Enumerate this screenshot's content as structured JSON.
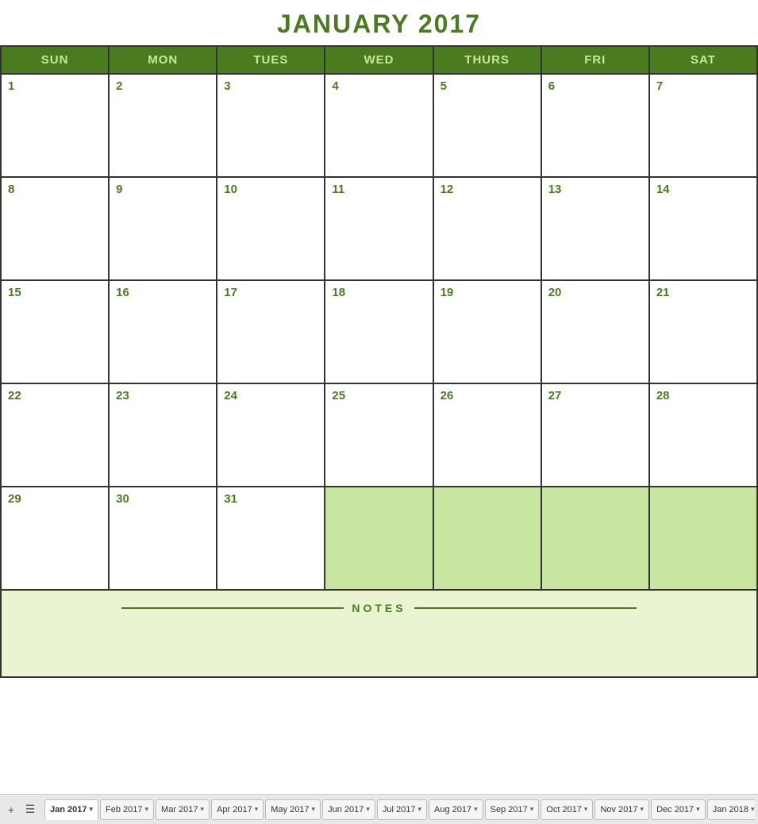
{
  "title": "JANUARY 2017",
  "colors": {
    "header_bg": "#4a7c1f",
    "header_text": "#c8e6a0",
    "date_text": "#4a7c1f",
    "empty_cell_bg": "#c8e6a0",
    "notes_bg": "#e8f5d0"
  },
  "day_headers": [
    "SUN",
    "MON",
    "TUES",
    "WED",
    "THURS",
    "FRI",
    "SAT"
  ],
  "weeks": [
    [
      {
        "date": "1",
        "empty": false
      },
      {
        "date": "2",
        "empty": false
      },
      {
        "date": "3",
        "empty": false
      },
      {
        "date": "4",
        "empty": false
      },
      {
        "date": "5",
        "empty": false
      },
      {
        "date": "6",
        "empty": false
      },
      {
        "date": "7",
        "empty": false
      }
    ],
    [
      {
        "date": "8",
        "empty": false
      },
      {
        "date": "9",
        "empty": false
      },
      {
        "date": "10",
        "empty": false
      },
      {
        "date": "11",
        "empty": false
      },
      {
        "date": "12",
        "empty": false
      },
      {
        "date": "13",
        "empty": false
      },
      {
        "date": "14",
        "empty": false
      }
    ],
    [
      {
        "date": "15",
        "empty": false
      },
      {
        "date": "16",
        "empty": false
      },
      {
        "date": "17",
        "empty": false
      },
      {
        "date": "18",
        "empty": false
      },
      {
        "date": "19",
        "empty": false
      },
      {
        "date": "20",
        "empty": false
      },
      {
        "date": "21",
        "empty": false
      }
    ],
    [
      {
        "date": "22",
        "empty": false
      },
      {
        "date": "23",
        "empty": false
      },
      {
        "date": "24",
        "empty": false
      },
      {
        "date": "25",
        "empty": false
      },
      {
        "date": "26",
        "empty": false
      },
      {
        "date": "27",
        "empty": false
      },
      {
        "date": "28",
        "empty": false
      }
    ],
    [
      {
        "date": "29",
        "empty": false
      },
      {
        "date": "30",
        "empty": false
      },
      {
        "date": "31",
        "empty": false
      },
      {
        "date": "",
        "empty": true
      },
      {
        "date": "",
        "empty": true
      },
      {
        "date": "",
        "empty": true
      },
      {
        "date": "",
        "empty": true
      }
    ]
  ],
  "notes_label": "NOTES",
  "tabs": [
    {
      "label": "Jan 2017",
      "active": true
    },
    {
      "label": "Feb 2017",
      "active": false
    },
    {
      "label": "Mar 2017",
      "active": false
    },
    {
      "label": "Apr 2017",
      "active": false
    },
    {
      "label": "May 2017",
      "active": false
    },
    {
      "label": "Jun 2017",
      "active": false
    },
    {
      "label": "Jul 2017",
      "active": false
    },
    {
      "label": "Aug 2017",
      "active": false
    },
    {
      "label": "Sep 2017",
      "active": false
    },
    {
      "label": "Oct 2017",
      "active": false
    },
    {
      "label": "Nov 2017",
      "active": false
    },
    {
      "label": "Dec 2017",
      "active": false
    },
    {
      "label": "Jan 2018",
      "active": false
    }
  ]
}
